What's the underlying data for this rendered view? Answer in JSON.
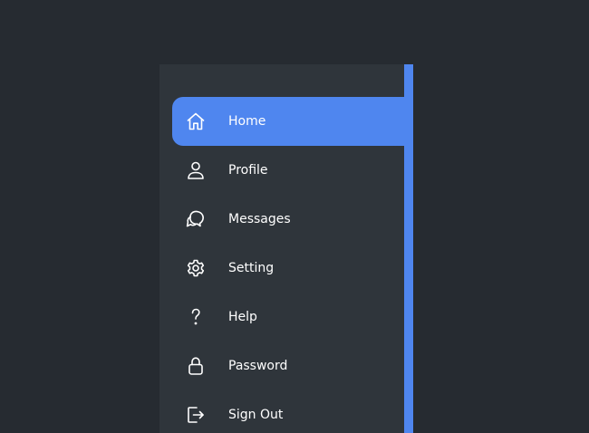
{
  "sidebar": {
    "active_index": 0,
    "accent_color": "#4f86ef",
    "panel_color": "#2f353b",
    "background_color": "#262b31",
    "items": [
      {
        "label": "Home",
        "icon": "home-icon"
      },
      {
        "label": "Profile",
        "icon": "user-icon"
      },
      {
        "label": "Messages",
        "icon": "chat-bubbles-icon"
      },
      {
        "label": "Setting",
        "icon": "gear-icon"
      },
      {
        "label": "Help",
        "icon": "question-mark-icon"
      },
      {
        "label": "Password",
        "icon": "lock-icon"
      },
      {
        "label": "Sign Out",
        "icon": "sign-out-icon"
      }
    ]
  }
}
